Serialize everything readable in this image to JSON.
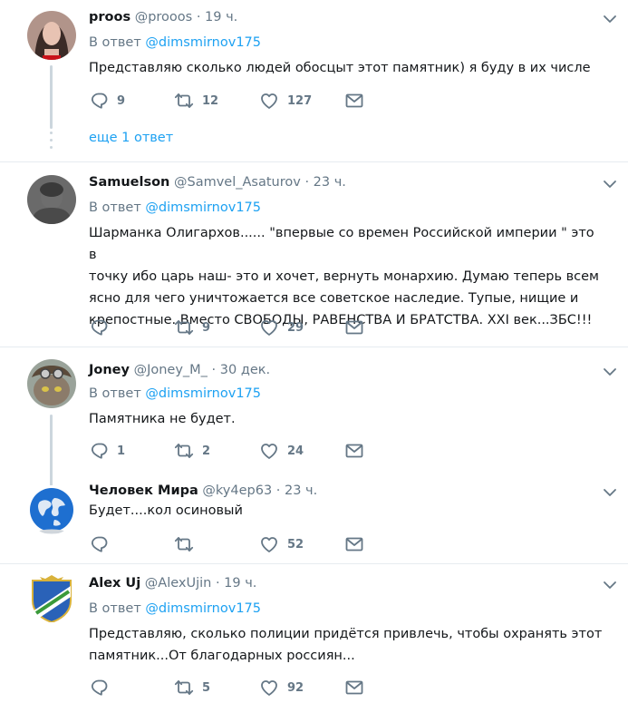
{
  "reply_prefix": "В ответ",
  "tweets": [
    {
      "name": "proos",
      "handle": "@prooos",
      "time": "19 ч.",
      "reply_to": "@dimsmirnov175",
      "text": "Представляю сколько людей обосцыт этот памятник) я буду в их числе",
      "replies": "9",
      "retweets": "12",
      "likes": "127",
      "more_link": "еще 1 ответ"
    },
    {
      "name": "Samuelson",
      "handle": "@Samvel_Asaturov",
      "time": "23 ч.",
      "reply_to": "@dimsmirnov175",
      "text_lines": [
        "Шарманка Олигархов...... \"впервые со времен Российской империи \" это в",
        "точку ибо царь наш- это и хочет,  вернуть монархию.  Думаю теперь всем",
        "ясно для чего уничтожается все советское наследие. Тупые,  нищие и",
        "крепостные. Вместо СВОБОДЫ, РАВЕНСТВА И БРАТСТВА. XXI век...ЗБС!!!"
      ],
      "replies": "",
      "retweets": "9",
      "likes": "29"
    },
    {
      "name": "Joney",
      "handle": "@Joney_M_",
      "time": "30 дек.",
      "reply_to": "@dimsmirnov175",
      "text": "Памятника не будет.",
      "replies": "1",
      "retweets": "2",
      "likes": "24"
    },
    {
      "name": "Человек Мира",
      "handle": "@ky4ep63",
      "time": "23 ч.",
      "text": "Будет....кол осиновый",
      "replies": "",
      "retweets": "",
      "likes": "52"
    },
    {
      "name": "Alex Uj",
      "handle": "@AlexUjin",
      "time": "19 ч.",
      "reply_to": "@dimsmirnov175",
      "text_lines": [
        "Представляю, сколько полиции придётся привлечь, чтобы охранять этот",
        "памятник...От благодарных россиян..."
      ],
      "replies": "",
      "retweets": "5",
      "likes": "92"
    }
  ],
  "colors": {
    "link": "#1da1f2",
    "secondary": "#657786",
    "separator": "#e6ecf0",
    "thread_line": "#ccd6dd"
  },
  "icons": [
    "reply-icon",
    "retweet-icon",
    "like-icon",
    "direct-message-icon",
    "chevron-down-icon"
  ]
}
